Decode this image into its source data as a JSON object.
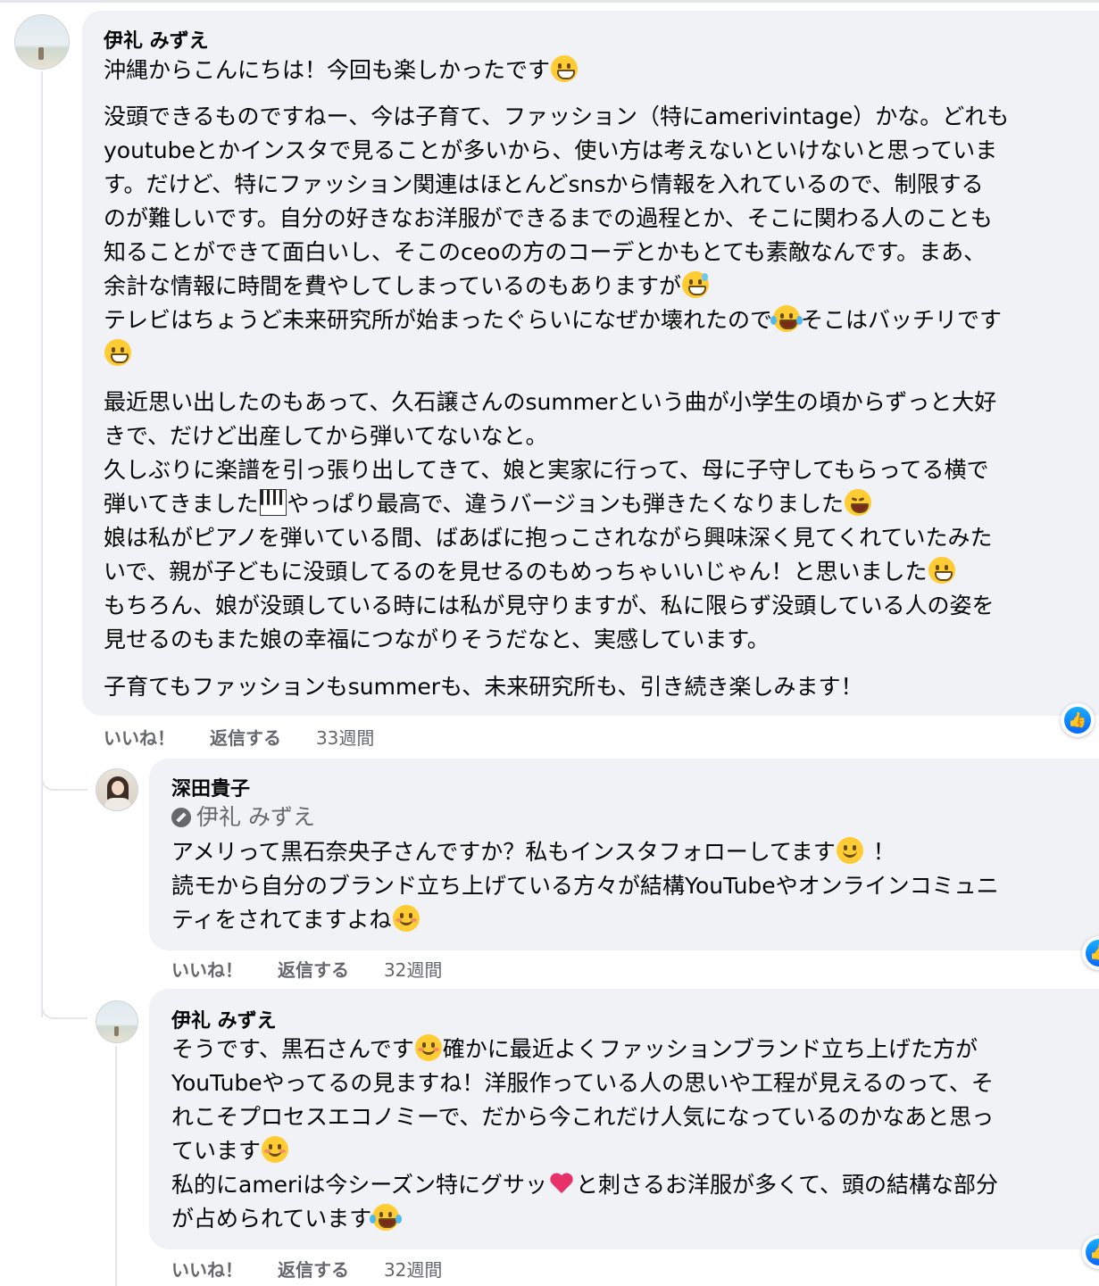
{
  "colors": {
    "bubble": "#f0f2f5",
    "meta": "#65676b",
    "like": "#0866ff"
  },
  "comment1": {
    "author": "伊礼 みずえ",
    "lines": {
      "l1": "沖縄からこんにちは！今回も楽しかったです",
      "l2": "没頭できるものですねー、今は子育て、ファッション（特にamerivintage）かな。どれも",
      "l3": "youtubeとかインスタで見ることが多いから、使い方は考えないといけないと思っていま",
      "l4": "す。だけど、特にファッション関連はほとんどsnsから情報を入れているので、制限する",
      "l5": "のが難しいです。自分の好きなお洋服ができるまでの過程とか、そこに関わる人のことも",
      "l6": "知ることができて面白いし、そこのceoの方のコーデとかもとても素敵なんです。まあ、",
      "l7": "余計な情報に時間を費やしてしまっているのもありますが",
      "l8a": "テレビはちょうど未来研究所が始まったぐらいになぜか壊れたので",
      "l8b": "そこはバッチリです",
      "l10": "最近思い出したのもあって、久石譲さんのsummerという曲が小学生の頃からずっと大好",
      "l11": "きで、だけど出産してから弾いてないなと。",
      "l12": "久しぶりに楽譜を引っ張り出してきて、娘と実家に行って、母に子守してもらってる横で",
      "l13a": "弾いてきました",
      "l13b": "やっぱり最高で、違うバージョンも弾きたくなりました",
      "l14": "娘は私がピアノを弾いている間、ばあばに抱っこされながら興味深く見てくれていたみた",
      "l15": "いで、親が子どもに没頭してるのを見せるのもめっちゃいいじゃん！と思いました",
      "l16": "もちろん、娘が没頭している時には私が見守りますが、私に限らず没頭している人の姿を",
      "l17": "見せるのもまた娘の幸福につながりそうだなと、実感しています。",
      "l18": "子育てもファッションもsummerも、未来研究所も、引き続き楽しみます！"
    },
    "like": "いいね！",
    "reply": "返信する",
    "time": "33週間"
  },
  "reply1": {
    "author": "深田貴子",
    "mention": "伊礼 みずえ",
    "lines": {
      "l1a": "アメリって黒石奈央子さんですか？私もインスタフォローしてます",
      "l1b": "！",
      "l2": "読モから自分のブランド立ち上げている方々が結構YouTubeやオンラインコミュニ",
      "l3": "ティをされてますよね"
    },
    "like": "いいね！",
    "reply": "返信する",
    "time": "32週間"
  },
  "reply2": {
    "author": "伊礼 みずえ",
    "lines": {
      "l1a": "そうです、黒石さんです",
      "l1b": "確かに最近よくファッションブランド立ち上げた方が",
      "l2": "YouTubeやってるの見ますね！洋服作っている人の思いや工程が見えるのって、そ",
      "l3": "れこそプロセスエコノミーで、だから今これだけ人気になっているのかなあと思っ",
      "l4": "ています",
      "l5a": "私的にameriは今シーズン特にグサッ",
      "l5b": "と刺さるお洋服が多くて、頭の結構な部分",
      "l6": "が占められています"
    },
    "like": "いいね！",
    "reply": "返信する",
    "time": "32週間"
  },
  "icons": [
    "grin-emoji",
    "sweat-smile-emoji",
    "tears-of-joy-emoji",
    "piano-emoji",
    "laughing-emoji",
    "smile-emoji",
    "blush-emoji",
    "heart-arrow-emoji",
    "like-icon",
    "tag-icon"
  ]
}
